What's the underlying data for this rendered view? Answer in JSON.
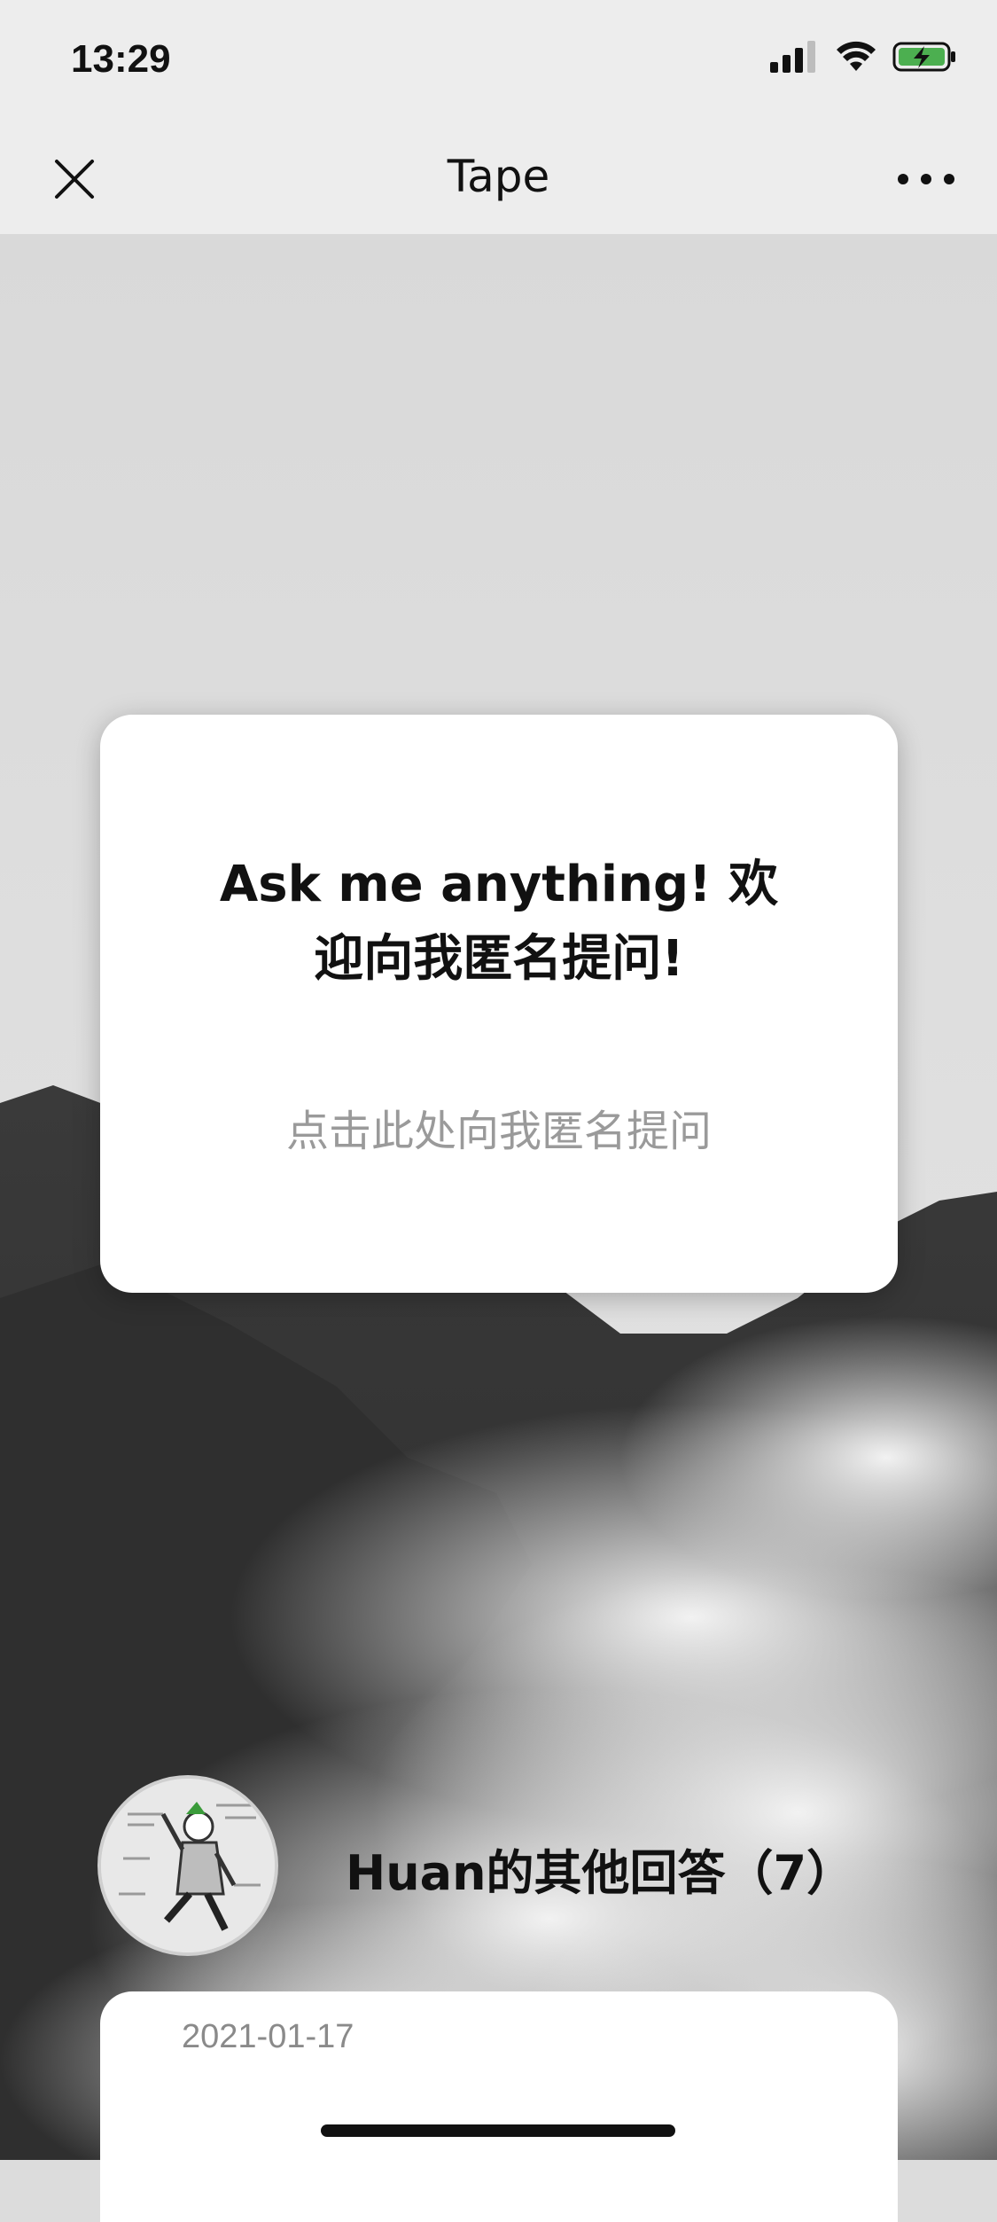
{
  "status_bar": {
    "time": "13:29",
    "icons": [
      "signal-icon",
      "wifi-icon",
      "battery-charging-icon"
    ],
    "battery_color": "#4caf50"
  },
  "nav": {
    "title": "Tape",
    "close_icon": "close-icon",
    "more_icon": "more-icon"
  },
  "ask_card": {
    "title": "Ask me anything! 欢迎向我匿名提问!",
    "prompt": "点击此处向我匿名提问"
  },
  "answers": {
    "header": "Huan的其他回答（7）",
    "first_card_date": "2021-01-17"
  },
  "background": {
    "description_icon": "mountain-clouds-image"
  }
}
